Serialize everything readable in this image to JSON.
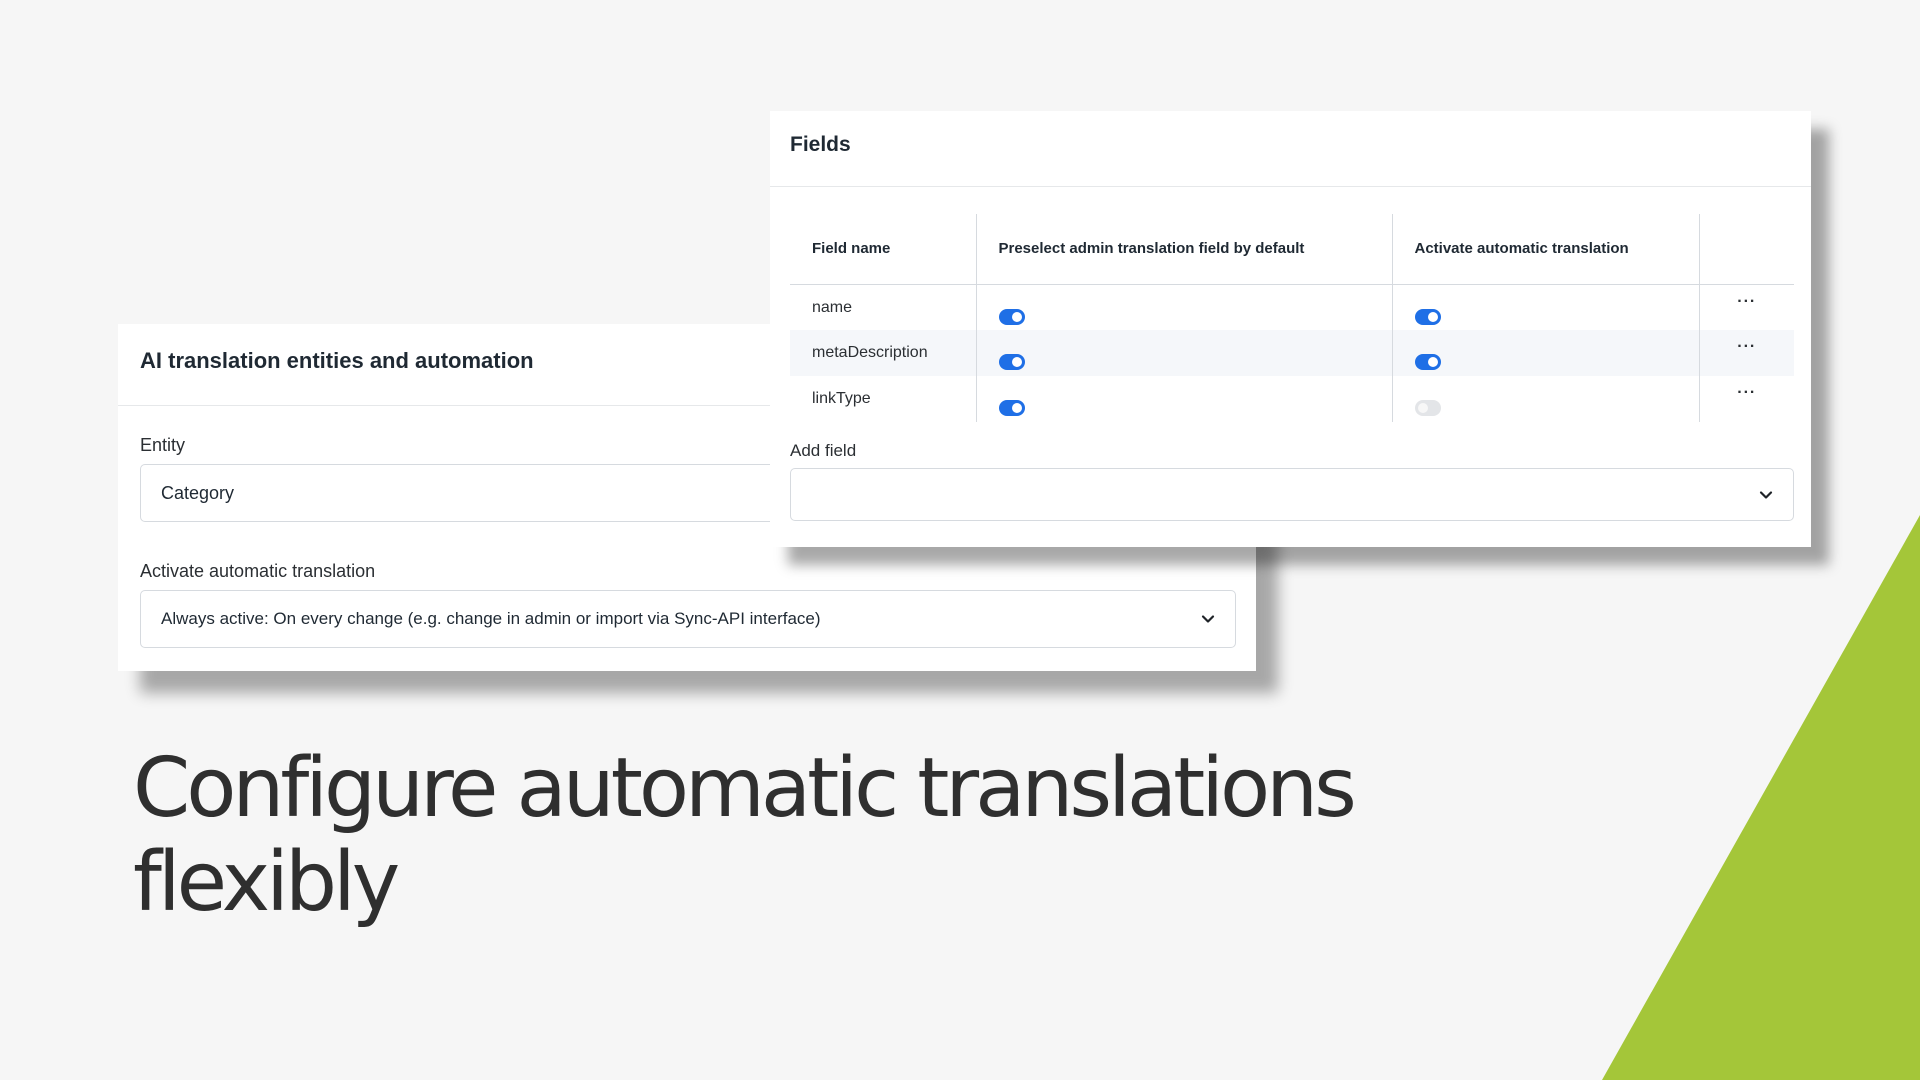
{
  "colors": {
    "background": "#f6f6f6",
    "accent_green": "#a4c639",
    "toggle_on": "#1f6fe6",
    "toggle_off": "#e3e5e8"
  },
  "left_panel": {
    "title": "AI translation entities and automation",
    "entity_label": "Entity",
    "entity_value": "Category",
    "activate_label": "Activate automatic translation",
    "activate_value": "Always active: On every change (e.g. change in admin or import via Sync-API interface)",
    "activate_icon": "chevron-down-icon"
  },
  "right_panel": {
    "title": "Fields",
    "columns": {
      "field_name": "Field name",
      "preselect": "Preselect admin translation field by default",
      "activate": "Activate automatic translation"
    },
    "rows": [
      {
        "name": "name",
        "preselect": true,
        "activate": true,
        "menu": "···"
      },
      {
        "name": "metaDescription",
        "preselect": true,
        "activate": true,
        "menu": "···"
      },
      {
        "name": "linkType",
        "preselect": true,
        "activate": false,
        "menu": "···"
      }
    ],
    "add_field_label": "Add field",
    "add_field_value": "",
    "add_field_icon": "chevron-down-icon"
  },
  "headline": {
    "line1": "Configure automatic translations",
    "line2": "flexibly"
  }
}
